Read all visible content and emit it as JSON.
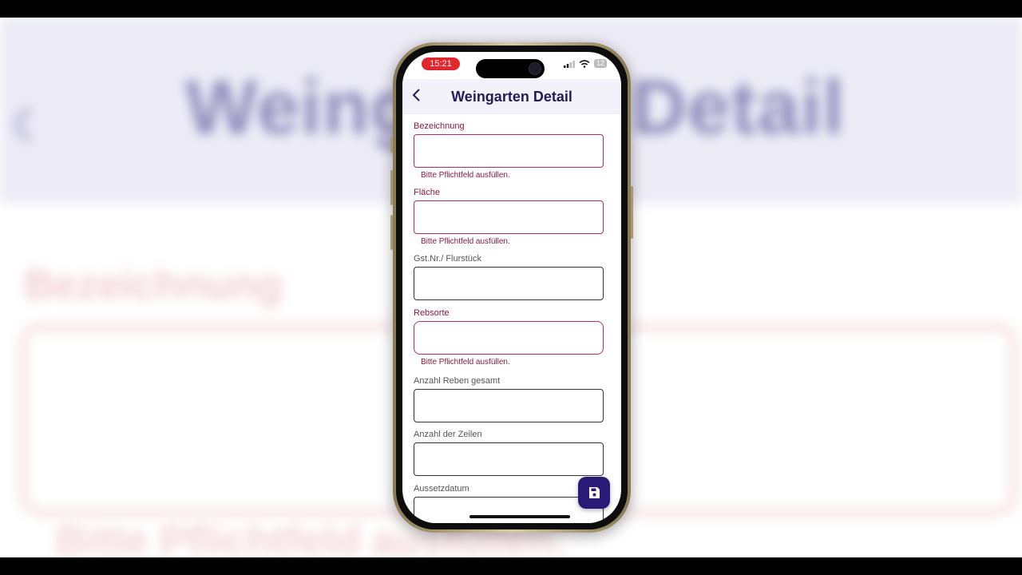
{
  "status_bar": {
    "time": "15:21",
    "battery": "12"
  },
  "nav": {
    "title": "Weingarten Detail"
  },
  "fields": [
    {
      "label": "Bezeichnung",
      "value": "",
      "required": true,
      "error": "Bitte Pflichtfeld ausfüllen."
    },
    {
      "label": "Fläche",
      "value": "",
      "required": true,
      "error": "Bitte Pflichtfeld ausfüllen."
    },
    {
      "label": "Gst.Nr./ Flurstück",
      "value": "",
      "required": false,
      "error": ""
    },
    {
      "label": "Rebsorte",
      "value": "",
      "required": true,
      "error": "Bitte Pflichtfeld ausfüllen."
    },
    {
      "label": "Anzahl Reben gesamt",
      "value": "",
      "required": false,
      "error": ""
    },
    {
      "label": "Anzahl der Zeilen",
      "value": "",
      "required": false,
      "error": ""
    },
    {
      "label": "Aussetzdatum",
      "value": "",
      "required": false,
      "error": ""
    }
  ],
  "background": {
    "title": "Weingarten Detail",
    "label": "Bezeichnung",
    "error": "Bitte Pflichtfeld ausfüllen."
  },
  "colors": {
    "accent": "#2a1a78",
    "title": "#221c58",
    "error": "#8b1a3d",
    "nav_bg": "#f3f2fa"
  },
  "icons": {
    "back": "chevron-left-icon",
    "save": "floppy-disk-icon"
  }
}
